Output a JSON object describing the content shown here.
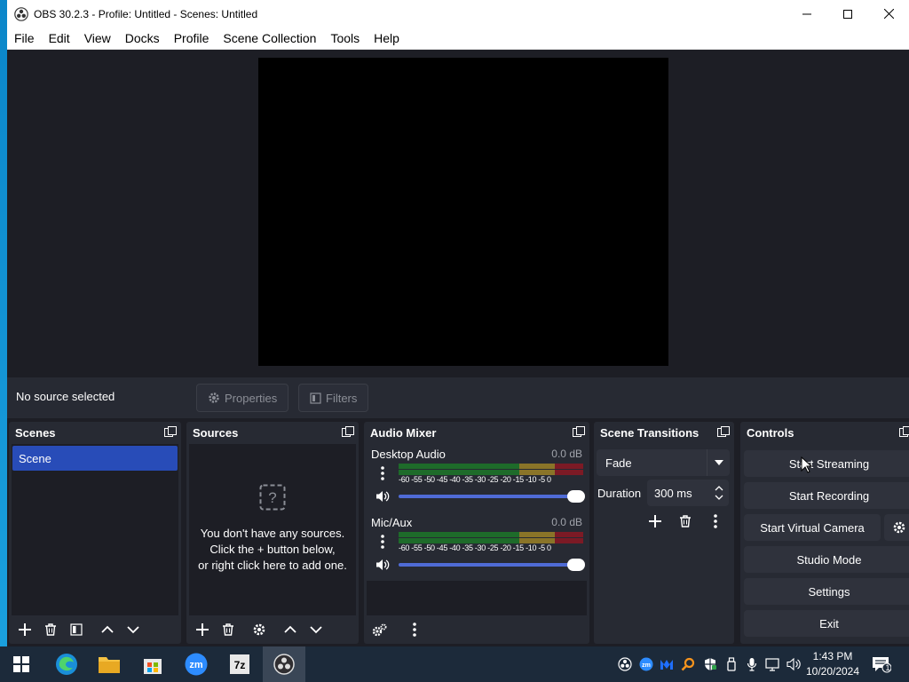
{
  "window": {
    "title": "OBS 30.2.3 - Profile: Untitled - Scenes: Untitled"
  },
  "menu": [
    "File",
    "Edit",
    "View",
    "Docks",
    "Profile",
    "Scene Collection",
    "Tools",
    "Help"
  ],
  "source_toolbar": {
    "no_source": "No source selected",
    "properties": "Properties",
    "filters": "Filters"
  },
  "scenes": {
    "title": "Scenes",
    "items": [
      "Scene"
    ]
  },
  "sources": {
    "title": "Sources",
    "empty_line1": "You don't have any sources.",
    "empty_line2": "Click the + button below,",
    "empty_line3": "or right click here to add one."
  },
  "mixer": {
    "title": "Audio Mixer",
    "channels": [
      {
        "name": "Desktop Audio",
        "db": "0.0 dB",
        "volume": 1.0
      },
      {
        "name": "Mic/Aux",
        "db": "0.0 dB",
        "volume": 1.0
      }
    ],
    "ticks": "-60 -55 -50 -45 -40 -35 -30 -25 -20 -15 -10 -5  0"
  },
  "transitions": {
    "title": "Scene Transitions",
    "selected": "Fade",
    "duration_label": "Duration",
    "duration_value": "300 ms"
  },
  "controls": {
    "title": "Controls",
    "start_streaming": "Start Streaming",
    "start_recording": "Start Recording",
    "start_virtual_camera": "Start Virtual Camera",
    "studio_mode": "Studio Mode",
    "settings": "Settings",
    "exit": "Exit"
  },
  "taskbar": {
    "time": "1:43 PM",
    "date": "10/20/2024",
    "notification_count": "1"
  },
  "colors": {
    "accent": "#284cb8",
    "panel": "#272a33",
    "background": "#1d1e25"
  }
}
